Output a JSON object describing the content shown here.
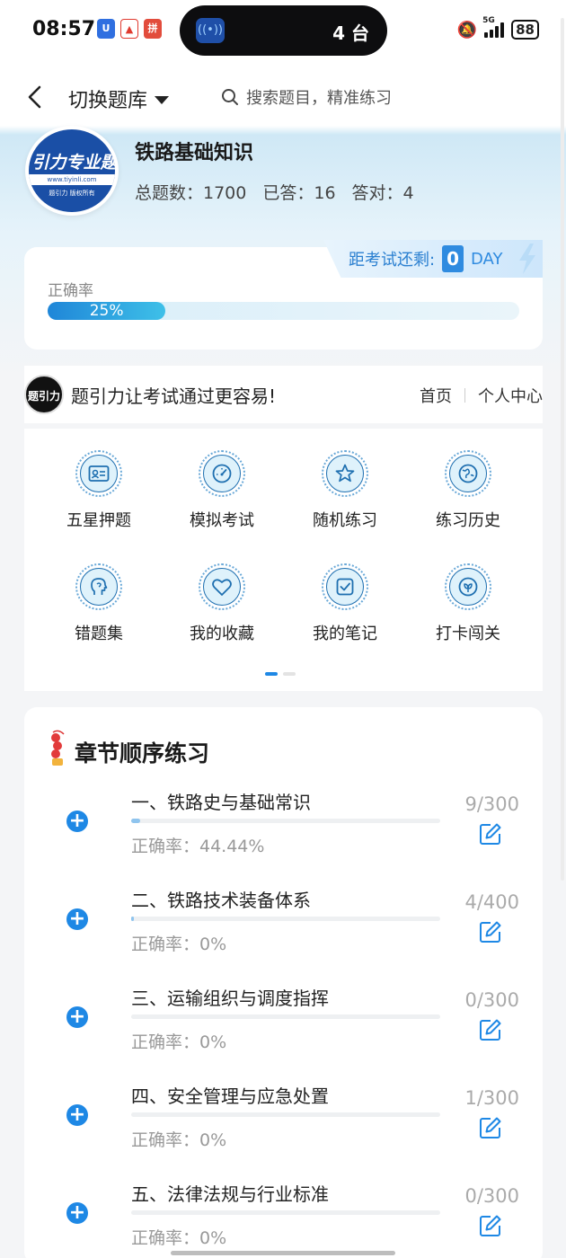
{
  "status_bar": {
    "time": "08:57",
    "island_badge": "4",
    "island_text": "4 台",
    "network": "5G",
    "battery": "88"
  },
  "header": {
    "switch_label": "切换题库",
    "search_placeholder": "搜索题目，精准练习"
  },
  "bank": {
    "logo_text": "引力专业题",
    "logo_url": "www.tiyinli.com",
    "logo_footer": "题引力 版权所有",
    "title": "铁路基础知识",
    "stats": [
      "总题数：1700",
      "已答：16",
      "答对：4"
    ]
  },
  "accuracy": {
    "label": "正确率",
    "value_text": "25%",
    "value": 0.25,
    "countdown_label": "距考试还剩:",
    "countdown_value": "0",
    "countdown_unit": "DAY"
  },
  "banner": {
    "logo_text": "题引力",
    "slogan": "题引力让考试通过更容易!",
    "links": [
      "首页",
      "个人中心"
    ]
  },
  "menu": [
    {
      "label": "五星押题",
      "icon": "id-card-icon"
    },
    {
      "label": "模拟考试",
      "icon": "gauge-icon"
    },
    {
      "label": "随机练习",
      "icon": "star-icon"
    },
    {
      "label": "练习历史",
      "icon": "globe-icon"
    },
    {
      "label": "错题集",
      "icon": "head-icon"
    },
    {
      "label": "我的收藏",
      "icon": "heart-icon"
    },
    {
      "label": "我的笔记",
      "icon": "note-check-icon"
    },
    {
      "label": "打卡闯关",
      "icon": "leaf-icon"
    }
  ],
  "chapters": {
    "title": "章节顺序练习",
    "items": [
      {
        "title": "一、铁路史与基础常识",
        "rate": "正确率：44.44%",
        "count": "9/300",
        "progress": 0.03
      },
      {
        "title": "二、铁路技术装备体系",
        "rate": "正确率：0%",
        "count": "4/400",
        "progress": 0.01
      },
      {
        "title": "三、运输组织与调度指挥",
        "rate": "正确率：0%",
        "count": "0/300",
        "progress": 0
      },
      {
        "title": "四、安全管理与应急处置",
        "rate": "正确率：0%",
        "count": "1/300",
        "progress": 0
      },
      {
        "title": "五、法律法规与行业标准",
        "rate": "正确率：0%",
        "count": "0/300",
        "progress": 0
      }
    ]
  },
  "colors": {
    "accent": "#1e88e5",
    "progress_start": "#1f86d8",
    "progress_end": "#3ec0e8"
  }
}
